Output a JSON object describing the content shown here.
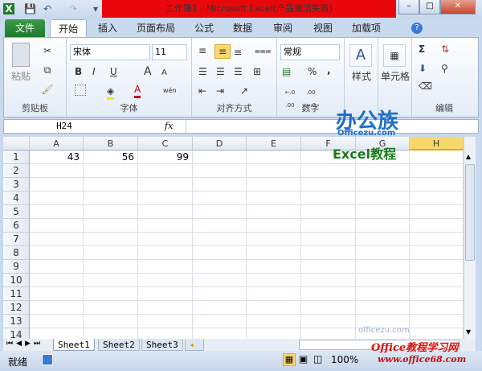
{
  "window": {
    "title": "工作簿1 - Microsoft Excel(产品激活失败)",
    "minimize": "–",
    "maximize": "□",
    "close": "✕"
  },
  "quick_access": {
    "excel": "X",
    "save": "💾",
    "undo": "↶",
    "redo": "↷",
    "customize": "▾"
  },
  "tabs": [
    {
      "label": "文件"
    },
    {
      "label": "开始"
    },
    {
      "label": "插入"
    },
    {
      "label": "页面布局"
    },
    {
      "label": "公式"
    },
    {
      "label": "数据"
    },
    {
      "label": "审阅"
    },
    {
      "label": "视图"
    },
    {
      "label": "加载项"
    }
  ],
  "ribbon": {
    "clipboard": {
      "label": "剪贴板",
      "paste": "粘贴"
    },
    "font": {
      "label": "字体",
      "name": "宋体",
      "size": "11",
      "bold": "B",
      "italic": "I",
      "underline": "U",
      "grow": "A",
      "shrink": "A",
      "color": "A",
      "phonetic": "wén"
    },
    "alignment": {
      "label": "对齐方式"
    },
    "number": {
      "label": "数字",
      "format": "常规",
      "percent": "%",
      "comma": ",",
      "inc_decimal": "←.0 .00",
      "dec_decimal": ".00 →.0"
    },
    "styles": {
      "label": "样式"
    },
    "cells": {
      "label": "单元格"
    },
    "editing": {
      "label": "编辑",
      "sum": "Σ"
    }
  },
  "formula_bar": {
    "name_box": "H24",
    "fx": "fx",
    "value": ""
  },
  "columns": [
    "A",
    "B",
    "C",
    "D",
    "E",
    "F",
    "G",
    "H"
  ],
  "selected_column": "H",
  "rows": [
    "1",
    "2",
    "3",
    "4",
    "5",
    "6",
    "7",
    "8",
    "9",
    "10",
    "11",
    "12",
    "13",
    "14"
  ],
  "cells": {
    "A1": "43",
    "B1": "56",
    "C1": "99"
  },
  "sheets": [
    "Sheet1",
    "Sheet2",
    "Sheet3"
  ],
  "active_sheet": "Sheet1",
  "status": {
    "ready": "就绪",
    "zoom": "100%"
  },
  "watermarks": {
    "logo1": "办公族",
    "logo1_url": "Officezu.com",
    "logo1_sub": "Excel教程",
    "logo2_faint": "officezu.com",
    "logo3": "Office教程学习网",
    "logo3_url": "www.office68.com"
  },
  "colors": {
    "title_bg": "#e8080c",
    "file_tab": "#2a8a38",
    "selected_header": "#f9d86b"
  }
}
